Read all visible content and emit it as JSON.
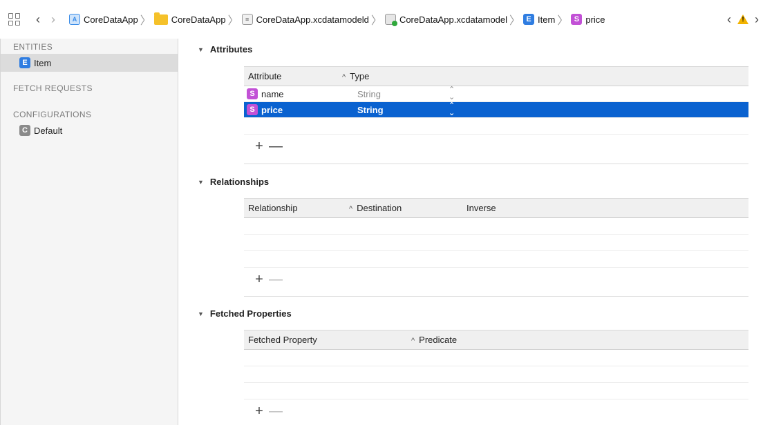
{
  "jumpbar": {
    "crumbs": [
      {
        "icon": "project-icon",
        "label": "CoreDataApp"
      },
      {
        "icon": "folder-icon",
        "label": "CoreDataApp"
      },
      {
        "icon": "document-icon",
        "label": "CoreDataApp.xcdatamodeld"
      },
      {
        "icon": "data-model-icon",
        "label": "CoreDataApp.xcdatamodel"
      },
      {
        "icon": "entity-icon",
        "label": "Item",
        "badge": "E"
      },
      {
        "icon": "string-attribute-icon",
        "label": "price",
        "badge": "S"
      }
    ]
  },
  "sidebar": {
    "entities_heading": "ENTITIES",
    "entity": {
      "badge": "E",
      "label": "Item"
    },
    "fetch_requests_heading": "FETCH REQUESTS",
    "configurations_heading": "CONFIGURATIONS",
    "configuration": {
      "badge": "C",
      "label": "Default"
    }
  },
  "attributes": {
    "title": "Attributes",
    "col_attribute": "Attribute",
    "col_type": "Type",
    "rows": [
      {
        "badge": "S",
        "name": "name",
        "type": "String"
      },
      {
        "badge": "S",
        "name": "price",
        "type": "String"
      }
    ],
    "add": "+",
    "remove": "—"
  },
  "relationships": {
    "title": "Relationships",
    "col_relationship": "Relationship",
    "col_destination": "Destination",
    "col_inverse": "Inverse",
    "add": "+",
    "remove": "—"
  },
  "fetched": {
    "title": "Fetched Properties",
    "col_property": "Fetched Property",
    "col_predicate": "Predicate",
    "add": "+",
    "remove": "—"
  },
  "colors": {
    "selection": "#0a62d0",
    "entity": "#2f7de1",
    "string": "#c251d6"
  }
}
